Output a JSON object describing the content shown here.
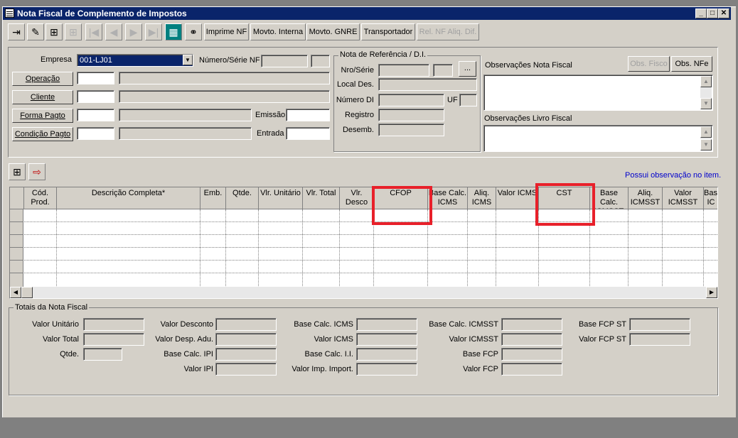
{
  "window": {
    "title": "Nota Fiscal de Complemento de Impostos"
  },
  "toolbar": {
    "icons": [
      "exit-icon",
      "eraser-icon",
      "add-icon",
      "add-disabled-icon",
      "first-icon",
      "prev-icon",
      "next-icon",
      "last-icon",
      "grid-icon",
      "binoculars-icon"
    ],
    "buttons": [
      "Imprime NF",
      "Movto. Interna",
      "Movto. GNRE",
      "Transportador",
      "Rel. NF Aliq. Dif."
    ]
  },
  "header": {
    "empresa_label": "Empresa",
    "empresa_value": "001-LJ01",
    "numero_serie_label": "Número/Série NF",
    "operacao_button": "Operação",
    "cliente_button": "Cliente",
    "forma_pagto_button": "Forma Pagto",
    "condicao_pagto_button": "Condição Pagto",
    "emissao_label": "Emissão",
    "entrada_label": "Entrada"
  },
  "nota_referencia": {
    "title": "Nota de Referência / D.I.",
    "nro_serie_label": "Nro/Série",
    "local_des_label": "Local Des.",
    "numero_di_label": "Número DI",
    "uf_label": "UF",
    "registro_label": "Registro",
    "desemb_label": "Desemb.",
    "browse_button": "..."
  },
  "observacoes": {
    "nf_label": "Observações Nota Fiscal",
    "livro_label": "Observações Livro Fiscal",
    "obs_fisco_button": "Obs. Fisco",
    "obs_nfe_button": "Obs. NFe"
  },
  "items": {
    "notice": "Possui observação no item.",
    "notice_color": "#0000cc",
    "columns": [
      "Cód.\nProd.",
      "Descrição Completa*",
      "Emb.",
      "Qtde.",
      "Vlr. Unitário",
      "Vlr. Total",
      "Vlr. Desco",
      "CFOP",
      "Base Calc.\nICMS",
      "Aliq.\nICMS",
      "Valor ICMS",
      "CST",
      "Base Calc.\nICMSST",
      "Aliq.\nICMSST",
      "Valor\nICMSST",
      "Base\nIC"
    ]
  },
  "highlight_color": "#e8202a",
  "totais": {
    "title": "Totais da Nota Fiscal",
    "col1": [
      "Valor Unitário",
      "Valor Total",
      "Qtde."
    ],
    "col2": [
      "Valor Desconto",
      "Valor Desp. Adu.",
      "Base Calc. IPI",
      "Valor IPI"
    ],
    "col3": [
      "Base Calc. ICMS",
      "Valor ICMS",
      "Base Calc. I.I.",
      "Valor Imp. Import."
    ],
    "col4": [
      "Base Calc. ICMSST",
      "Valor ICMSST",
      "Base FCP",
      "Valor FCP"
    ],
    "col5": [
      "Base FCP ST",
      "Valor FCP ST"
    ]
  }
}
